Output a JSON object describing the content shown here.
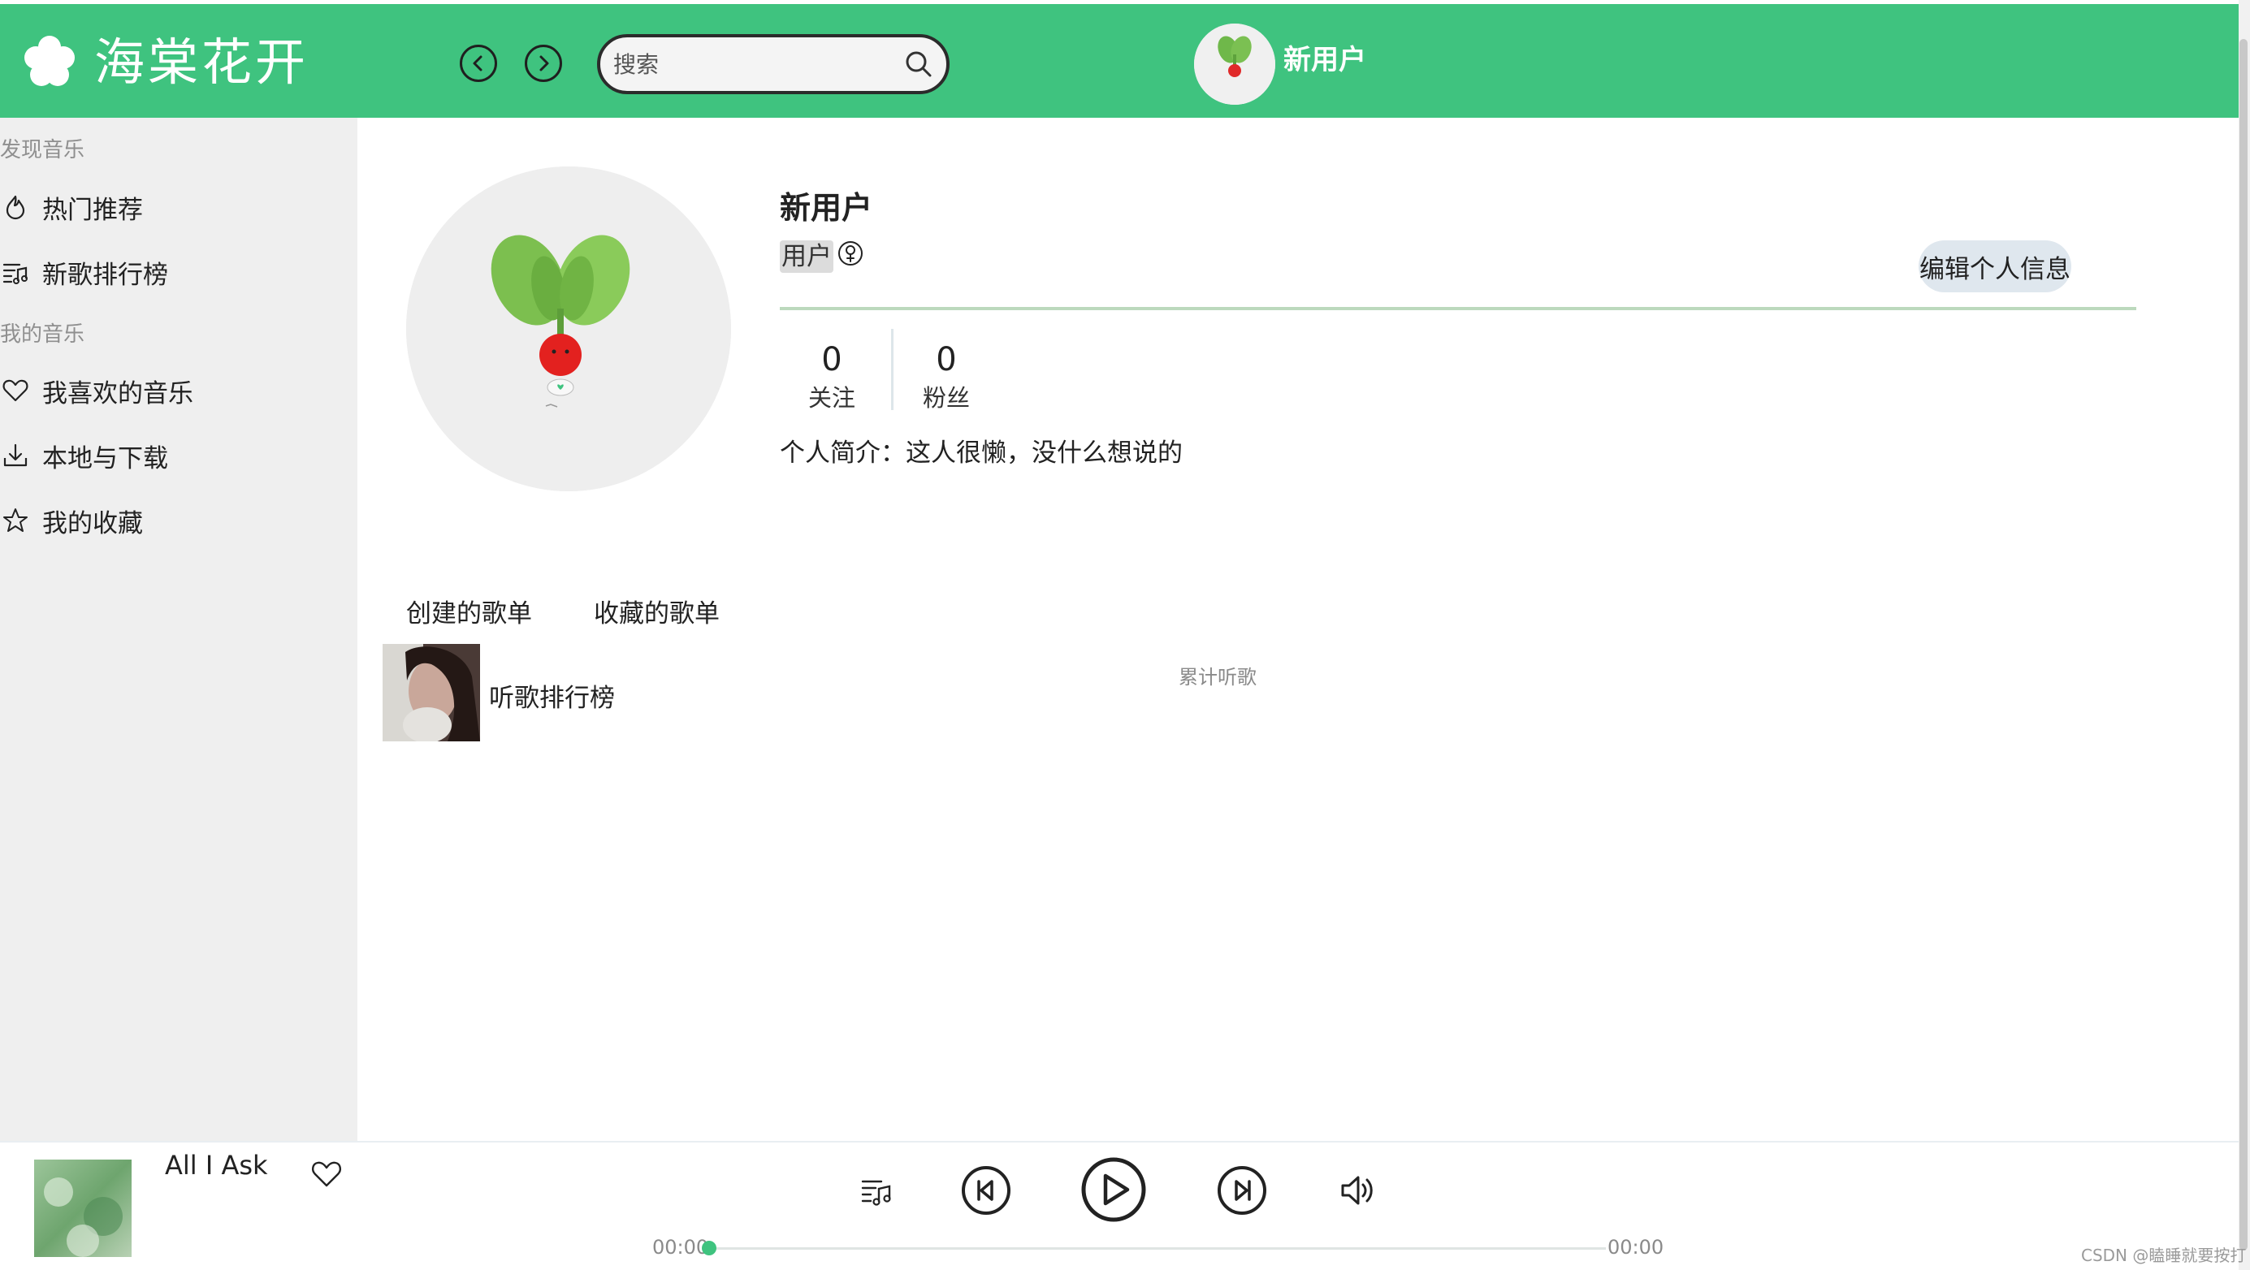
{
  "app": {
    "name": "海棠花开",
    "brand_color": "#3fc37f"
  },
  "header": {
    "search_placeholder": "搜索",
    "username": "新用户"
  },
  "sidebar": {
    "sections": [
      {
        "title": "发现音乐",
        "items": [
          {
            "label": "热门推荐",
            "icon": "fire-icon"
          },
          {
            "label": "新歌排行榜",
            "icon": "playlist-icon"
          }
        ]
      },
      {
        "title": "我的音乐",
        "items": [
          {
            "label": "我喜欢的音乐",
            "icon": "heart-icon"
          },
          {
            "label": "本地与下载",
            "icon": "download-icon"
          },
          {
            "label": "我的收藏",
            "icon": "star-icon"
          }
        ]
      }
    ]
  },
  "profile": {
    "name": "新用户",
    "role": "用户",
    "gender_icon": "female-icon",
    "edit_label": "编辑个人信息",
    "stats": [
      {
        "value": "0",
        "label": "关注"
      },
      {
        "value": "0",
        "label": "粉丝"
      }
    ],
    "bio_label": "个人简介：",
    "bio_text": "这人很懒，没什么想说的"
  },
  "tabs": [
    "创建的歌单",
    "收藏的歌单"
  ],
  "playlists": [
    {
      "name": "听歌排行榜"
    }
  ],
  "listen_count_label": "累计听歌",
  "player": {
    "song_title": "All I Ask",
    "current_time": "00:00",
    "total_time": "00:00",
    "progress": 0
  },
  "watermark": "CSDN @瞌睡就要按打"
}
